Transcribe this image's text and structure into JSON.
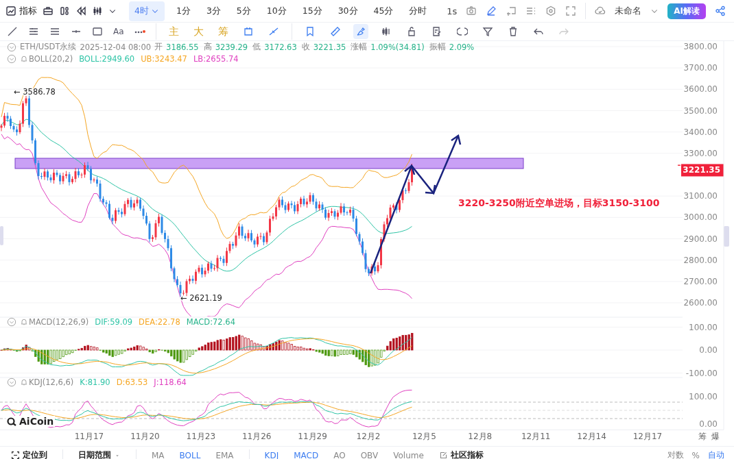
{
  "toolbar": {
    "indicators_label": "指标",
    "intervals": [
      {
        "label": "4时",
        "selected": true
      },
      {
        "label": "1分",
        "selected": false
      },
      {
        "label": "3分",
        "selected": false
      },
      {
        "label": "5分",
        "selected": false
      },
      {
        "label": "10分",
        "selected": false
      },
      {
        "label": "15分",
        "selected": false
      },
      {
        "label": "30分",
        "selected": false
      },
      {
        "label": "45分",
        "selected": false
      },
      {
        "label": "分时",
        "selected": false
      }
    ],
    "speed": "1s",
    "layout_name": "未命名",
    "ai_button": "AI解读"
  },
  "drawing_bar": {
    "text_tool": "Aa",
    "chips": [
      "主",
      "大",
      "筹"
    ],
    "tools": [
      {
        "selected": false
      },
      {
        "selected": false
      },
      {
        "selected": false
      },
      {
        "selected": false
      },
      {
        "selected": true
      },
      {
        "selected": false
      },
      {
        "selected": false
      },
      {
        "selected": false
      },
      {
        "selected": false
      },
      {
        "selected": false
      },
      {
        "selected": false
      },
      {
        "selected": false
      },
      {
        "selected": false
      }
    ]
  },
  "legend": {
    "symbol": "ETH/USDT永续",
    "time": "2025-12-04 08:00",
    "fields": [
      {
        "label": "开",
        "value": "3186.55"
      },
      {
        "label": "高",
        "value": "3239.29"
      },
      {
        "label": "低",
        "value": "3172.63"
      },
      {
        "label": "收",
        "value": "3221.35"
      },
      {
        "label": "涨幅",
        "value": "1.09%(34.81)"
      },
      {
        "label": "振幅",
        "value": "2.09%"
      }
    ]
  },
  "panes": [
    {
      "name": "BOLL(20,2)",
      "values": [
        {
          "text": "BOLL:2949.60",
          "color": "#2ec4a6"
        },
        {
          "text": "UB:3243.47",
          "color": "#f5a623"
        },
        {
          "text": "LB:2655.74",
          "color": "#e040c0"
        }
      ],
      "ticks": [
        "3800.00",
        "3700.00",
        "3600.00",
        "3500.00",
        "3400.00",
        "3300.00",
        "3100.00",
        "3000.00",
        "2900.00",
        "2800.00",
        "2700.00",
        "2600.00"
      ]
    },
    {
      "name": "MACD(12,26,9)",
      "values": [
        {
          "text": "DIF:59.09",
          "color": "#2ec4a6"
        },
        {
          "text": "DEA:22.78",
          "color": "#f5a623"
        },
        {
          "text": "MACD:72.64",
          "color": "#26b38a"
        }
      ],
      "ticks": [
        "100.00",
        "0.00",
        "-100.00"
      ]
    },
    {
      "name": "KDJ(12,6,6)",
      "values": [
        {
          "text": "K:81.90",
          "color": "#2ec4a6"
        },
        {
          "text": "D:63.53",
          "color": "#f5a623"
        },
        {
          "text": "J:118.64",
          "color": "#e040c0"
        }
      ],
      "ticks": [
        "100.00",
        "0.00"
      ]
    }
  ],
  "current_price": "3221.35",
  "high_marker": "← 3586.78",
  "low_marker": "← 2621.19",
  "note": "3220-3250附近空单进场，目标3150-3100",
  "logo": "AiCoin",
  "x_axis": [
    "11月17",
    "11月20",
    "11月23",
    "11月26",
    "11月29",
    "12月2",
    "12月5",
    "12月8",
    "12月11",
    "12月14",
    "12月17"
  ],
  "x_axis_right": [
    "筹",
    "爆"
  ],
  "bottom_bar": {
    "locate": "定位到",
    "date_range": "日期范围",
    "groups": [
      [
        {
          "label": "MA",
          "selected": false
        },
        {
          "label": "BOLL",
          "selected": true
        },
        {
          "label": "EMA",
          "selected": false
        }
      ],
      [
        {
          "label": "KDJ",
          "selected": true
        },
        {
          "label": "MACD",
          "selected": true
        },
        {
          "label": "AO",
          "selected": false
        },
        {
          "label": "OBV",
          "selected": false
        },
        {
          "label": "Volume",
          "selected": false
        }
      ]
    ],
    "community": "社区指标",
    "options": [
      {
        "label": "对数",
        "selected": false
      },
      {
        "label": "%",
        "selected": false
      },
      {
        "label": "自动",
        "selected": true
      }
    ]
  }
}
